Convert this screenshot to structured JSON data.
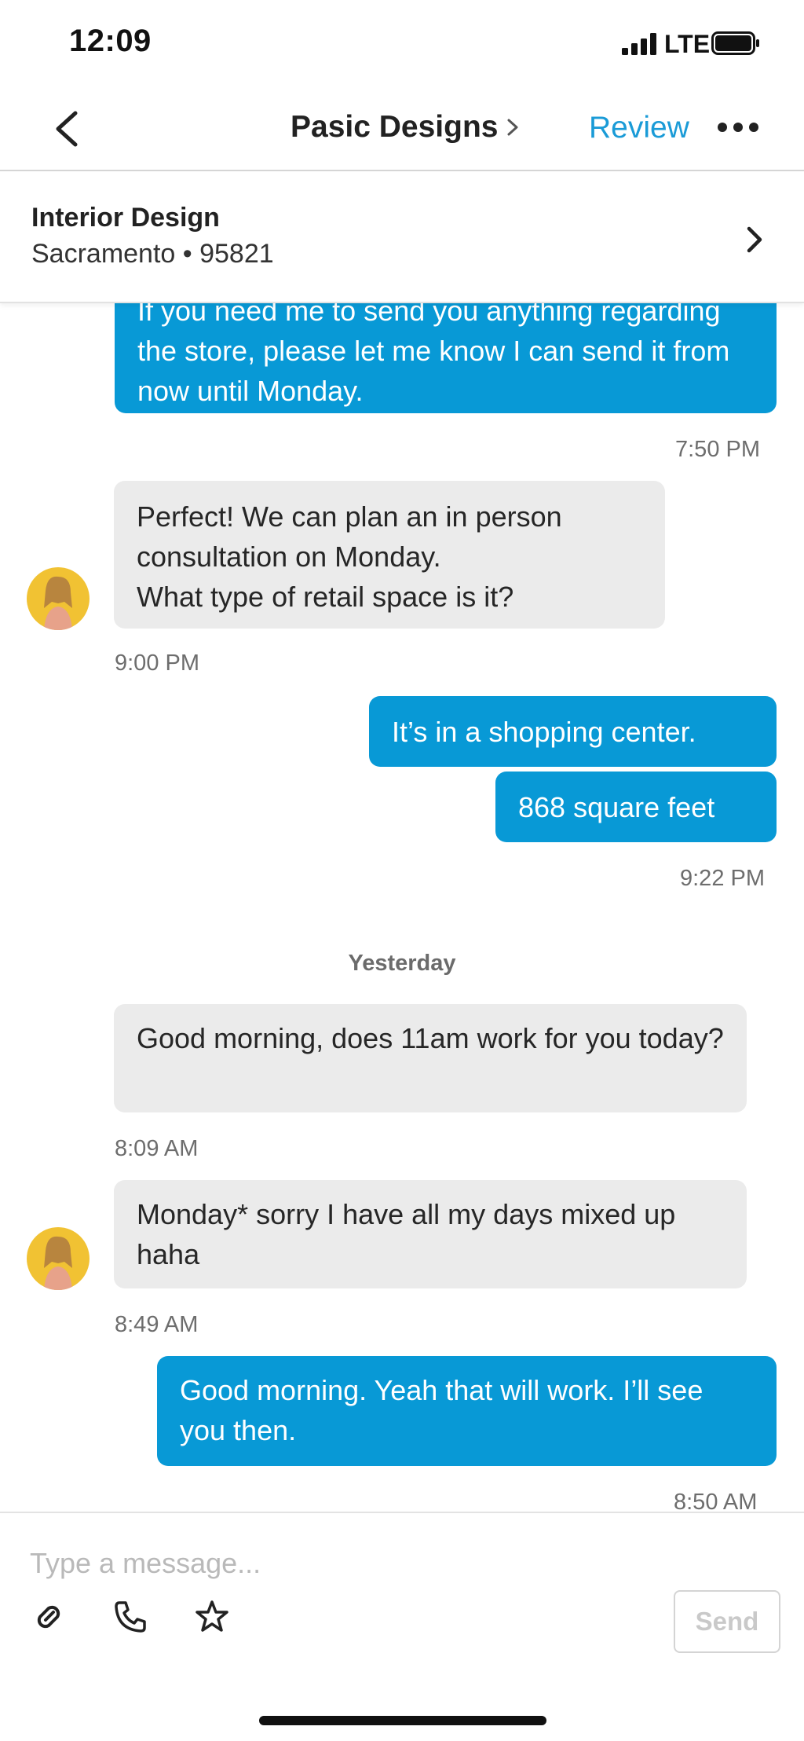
{
  "status_bar": {
    "time": "12:09",
    "network": "LTE"
  },
  "header": {
    "title": "Pasic Designs",
    "action_label": "Review"
  },
  "project": {
    "category": "Interior Design",
    "location": "Sacramento • 95821"
  },
  "messages": [
    {
      "direction": "outgoing",
      "text": "If you need me to send you anything regarding the store, please let me know I can send it from now until Monday."
    },
    {
      "timestamp": "7:50 PM"
    },
    {
      "direction": "incoming",
      "text": "Perfect! We can plan an in person consultation on Monday.\nWhat type of retail space is it?"
    },
    {
      "timestamp": "9:00 PM"
    },
    {
      "direction": "outgoing",
      "text": "It’s in a shopping center."
    },
    {
      "direction": "outgoing",
      "text": "868 square feet"
    },
    {
      "timestamp": "9:22 PM"
    },
    {
      "day_separator": "Yesterday"
    },
    {
      "direction": "incoming",
      "text": "Good morning, does 11am work for you today?"
    },
    {
      "timestamp": "8:09 AM"
    },
    {
      "direction": "incoming",
      "text": "Monday* sorry I have all my days mixed up haha"
    },
    {
      "timestamp": "8:49 AM"
    },
    {
      "direction": "outgoing",
      "text": "Good morning. Yeah that will work. I’ll see you then."
    },
    {
      "timestamp": "8:50 AM"
    }
  ],
  "composer": {
    "placeholder": "Type a message...",
    "send_label": "Send"
  },
  "icons": {
    "back": "chevron-left-icon",
    "more": "more-horizontal-icon",
    "attach": "paperclip-icon",
    "call": "phone-icon",
    "favorite": "star-icon"
  },
  "colors": {
    "accent": "#1a9bd7",
    "outgoing_bubble": "#0899d6",
    "incoming_bubble": "#ebebeb"
  }
}
